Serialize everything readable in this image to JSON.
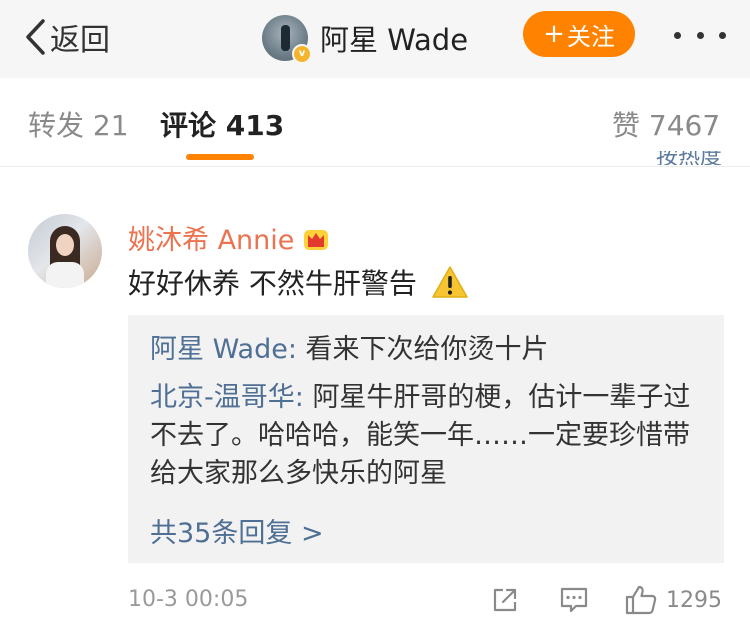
{
  "header": {
    "back_label": "返回",
    "user_name": "阿星 Wade",
    "follow_label": "关注"
  },
  "tabs": [
    {
      "label": "转发 21"
    },
    {
      "label": "评论 413",
      "active": true
    },
    {
      "label": "赞 7467"
    }
  ],
  "sort_peek": "按热度",
  "comment": {
    "author": "姚沐希 Annie",
    "text": "好好休养 不然牛肝警告",
    "replies": [
      {
        "author": "阿星 Wade",
        "text": "看来下次给你烫十片"
      },
      {
        "author": "北京-温哥华",
        "text": "阿星牛肝哥的梗，估计一辈子过不去了。哈哈哈，能笑一年……一定要珍惜带给大家那么多快乐的阿星"
      }
    ],
    "more_replies": "共35条回复 >",
    "time": "10-3 00:05",
    "like_count": "1295"
  },
  "colors": {
    "accent": "#ff8200",
    "link": "#4f6f94",
    "author_name": "#eb7350"
  },
  "icons": [
    "chevron-left-icon",
    "verified-badge-icon",
    "more-dots-icon",
    "crown-vip-icon",
    "warning-icon",
    "share-icon",
    "comment-icon",
    "like-icon"
  ]
}
